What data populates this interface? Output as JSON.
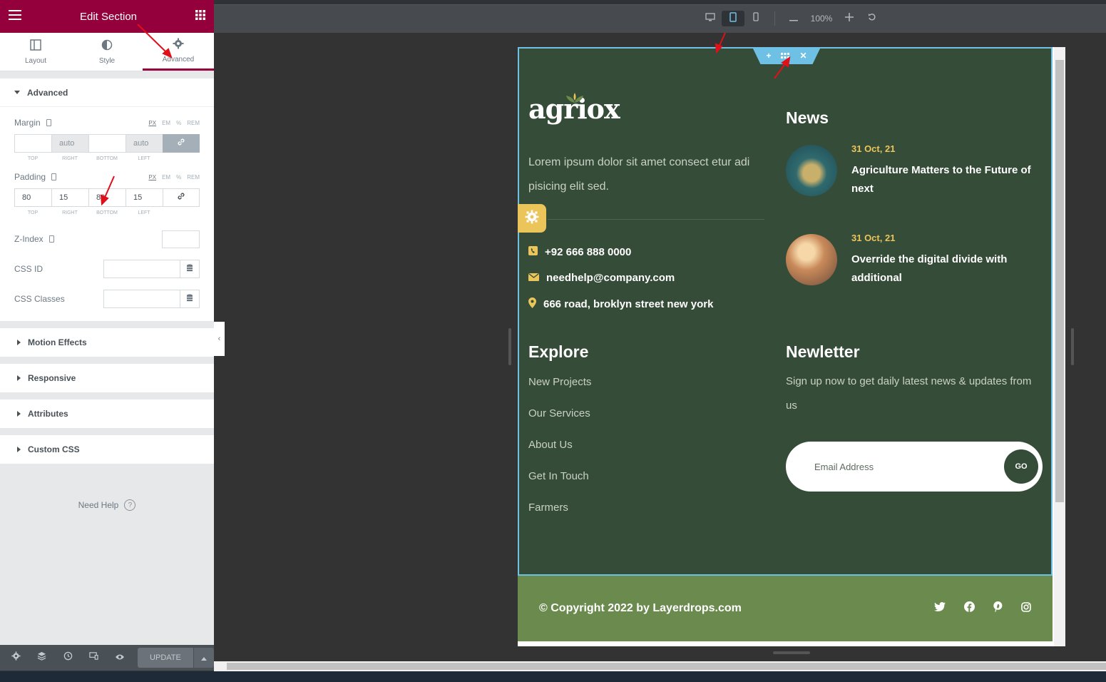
{
  "panel": {
    "title": "Edit Section",
    "tabs": [
      {
        "label": "Layout",
        "icon": "layout-icon"
      },
      {
        "label": "Style",
        "icon": "style-icon"
      },
      {
        "label": "Advanced",
        "icon": "gear-icon"
      }
    ],
    "advanced": {
      "heading": "Advanced",
      "units": [
        "PX",
        "EM",
        "%",
        "REM"
      ],
      "margin": {
        "label": "Margin",
        "top": "",
        "right": "auto",
        "bottom": "",
        "left": "auto"
      },
      "padding": {
        "label": "Padding",
        "top": "80",
        "right": "15",
        "bottom": "80",
        "left": "15"
      },
      "dim_labels": [
        "TOP",
        "RIGHT",
        "BOTTOM",
        "LEFT"
      ],
      "z_index_label": "Z-Index",
      "css_id_label": "CSS ID",
      "css_classes_label": "CSS Classes"
    },
    "collapsed_sections": [
      "Motion Effects",
      "Responsive",
      "Attributes",
      "Custom CSS"
    ],
    "need_help": "Need Help",
    "update_label": "UPDATE"
  },
  "toolbar": {
    "zoom": "100%"
  },
  "preview": {
    "logo": "agriox",
    "about": "Lorem ipsum dolor sit amet consect etur adi pisicing elit sed.",
    "contacts": [
      {
        "icon": "phone-icon",
        "text": "+92 666 888 0000"
      },
      {
        "icon": "envelope-icon",
        "text": "needhelp@company.com"
      },
      {
        "icon": "map-pin-icon",
        "text": "666 road, broklyn street new york"
      }
    ],
    "news_title": "News",
    "news": [
      {
        "date": "31 Oct, 21",
        "title": "Agriculture Matters to the Future of next"
      },
      {
        "date": "31 Oct, 21",
        "title": "Override the digital divide with additional"
      }
    ],
    "explore_title": "Explore",
    "explore_links": [
      "New Projects",
      "Our Services",
      "About Us",
      "Get In Touch",
      "Farmers"
    ],
    "newsletter_title": "Newletter",
    "newsletter_text": "Sign up now to get daily latest news & updates from us",
    "email_placeholder": "Email Address",
    "go_label": "GO",
    "copyright": "© Copyright 2022 by Layerdrops.com",
    "socials": [
      "twitter-icon",
      "facebook-icon",
      "pinterest-icon",
      "instagram-icon"
    ]
  },
  "colors": {
    "editor_accent": "#93003c",
    "footer_bg": "#354c38",
    "copyright_bg": "#6b8a4e",
    "highlight_yellow": "#ecc55a",
    "selection_blue": "#6ec1e4"
  }
}
